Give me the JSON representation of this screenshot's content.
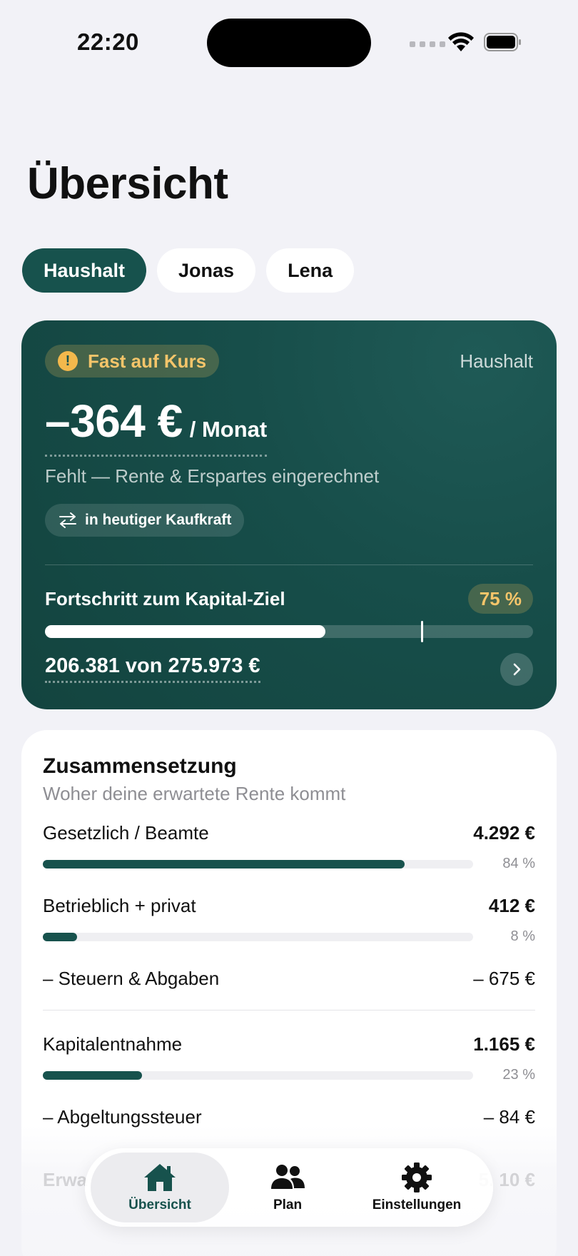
{
  "status": {
    "time": "22:20"
  },
  "page": {
    "title": "Übersicht"
  },
  "segments": [
    {
      "label": "Haushalt",
      "active": true
    },
    {
      "label": "Jonas",
      "active": false
    },
    {
      "label": "Lena",
      "active": false
    }
  ],
  "hero": {
    "badge": "Fast auf Kurs",
    "badge_icon": "!",
    "scope": "Haushalt",
    "amount": "–364 €",
    "amount_unit": "/ Monat",
    "subtitle": "Fehlt — Rente & Erspartes eingerechnet",
    "kaufkraft": "in heutiger Kaufkraft",
    "progress_label": "Fortschritt zum Kapital-Ziel",
    "progress_percent_text": "75 %",
    "progress_fraction": 0.575,
    "marker_fraction": 0.77,
    "progress_values": "206.381 von 275.973 €",
    "accent": "#17524d",
    "warning": "#f5c56a"
  },
  "composition": {
    "title": "Zusammensetzung",
    "subtitle": "Woher deine erwartete Rente kommt",
    "rows": [
      {
        "label": "Gesetzlich / Beamte",
        "value": "4.292 €",
        "percent": "84 %",
        "fraction": 0.84
      },
      {
        "label": "Betrieblich + privat",
        "value": "412 €",
        "percent": "8 %",
        "fraction": 0.08
      },
      {
        "label": "– Steuern & Abgaben",
        "value": "– 675 €"
      },
      {
        "label": "Kapitalentnahme",
        "value": "1.165 €",
        "percent": "23 %",
        "fraction": 0.23
      },
      {
        "label": "– Abgeltungssteuer",
        "value": "– 84 €"
      },
      {
        "label": "Erwa",
        "value": "5. 10 €"
      }
    ]
  },
  "tabbar": {
    "tabs": [
      {
        "label": "Übersicht",
        "icon": "house-icon",
        "active": true
      },
      {
        "label": "Plan",
        "icon": "people-icon",
        "active": false
      },
      {
        "label": "Einstellungen",
        "icon": "gear-icon",
        "active": false
      }
    ]
  }
}
